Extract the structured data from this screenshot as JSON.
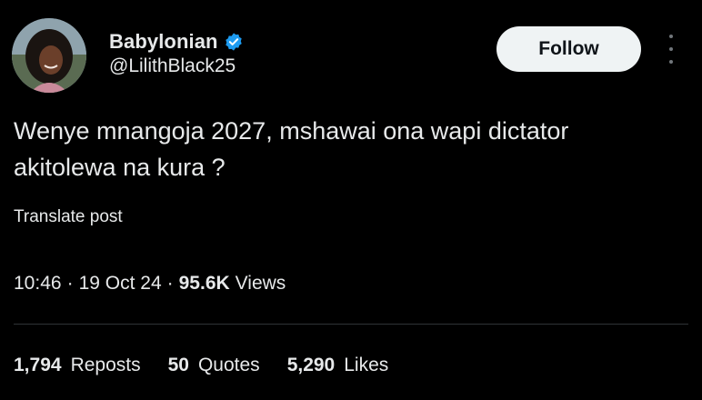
{
  "author": {
    "display_name": "Babylonian",
    "handle": "@LilithBlack25",
    "verified": true,
    "verified_color": "#1d9bf0",
    "avatar_icon": "profile-photo"
  },
  "actions": {
    "follow_label": "Follow",
    "more_icon": "more-vertical-icon"
  },
  "post": {
    "text": "Wenye mnangoja 2027, mshawai ona wapi dictator\nakitolewa na kura ?",
    "translate_label": "Translate post"
  },
  "meta": {
    "time": "10:46",
    "date": "19 Oct 24",
    "separator": "·",
    "views_count": "95.6K",
    "views_label": "Views"
  },
  "stats": [
    {
      "count": "1,794",
      "label": "Reposts"
    },
    {
      "count": "50",
      "label": "Quotes"
    },
    {
      "count": "5,290",
      "label": "Likes"
    }
  ],
  "colors": {
    "background": "#000000",
    "text": "#e7e9ea",
    "button_bg": "#eff3f4",
    "button_text": "#0f1419",
    "divider": "#2f3336"
  }
}
